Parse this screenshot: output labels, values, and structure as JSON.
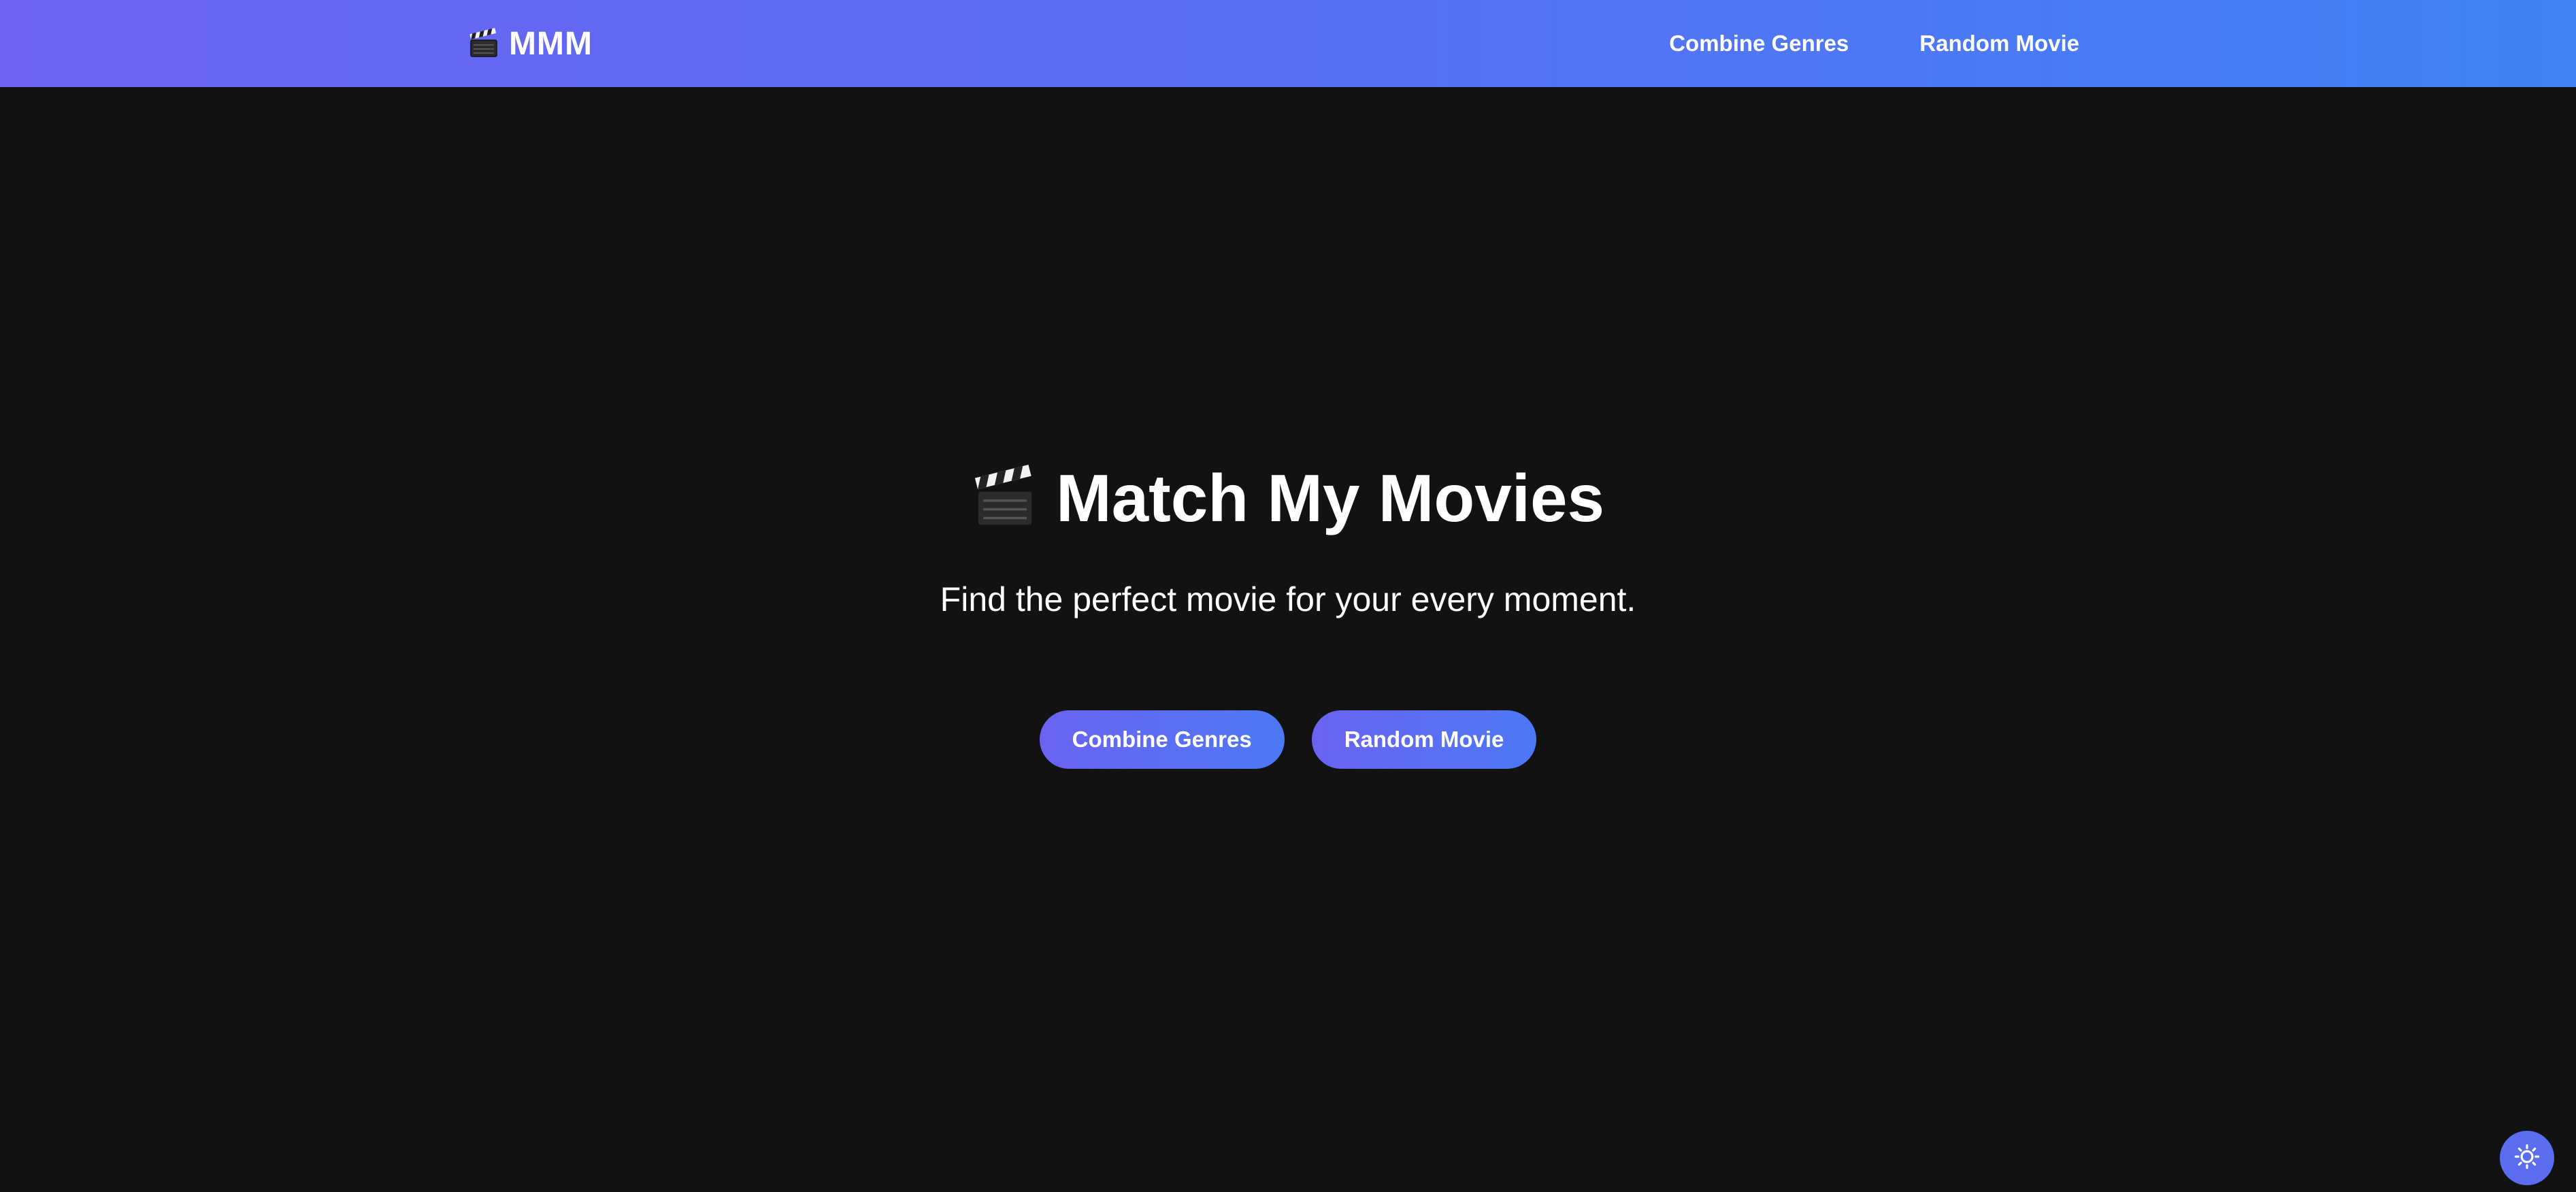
{
  "navbar": {
    "brand": "MMM",
    "links": [
      {
        "label": "Combine Genres"
      },
      {
        "label": "Random Movie"
      }
    ]
  },
  "hero": {
    "title": "Match My Movies",
    "subtitle": "Find the perfect movie for your every moment.",
    "buttons": [
      {
        "label": "Combine Genres"
      },
      {
        "label": "Random Movie"
      }
    ]
  },
  "theme_toggle": {
    "icon": "sun-icon"
  },
  "icons": {
    "brand": "clapperboard-icon",
    "title": "clapperboard-icon"
  },
  "colors": {
    "background": "#121212",
    "gradient_start": "#6c63f4",
    "gradient_end": "#3f83f6",
    "text": "#ffffff"
  }
}
